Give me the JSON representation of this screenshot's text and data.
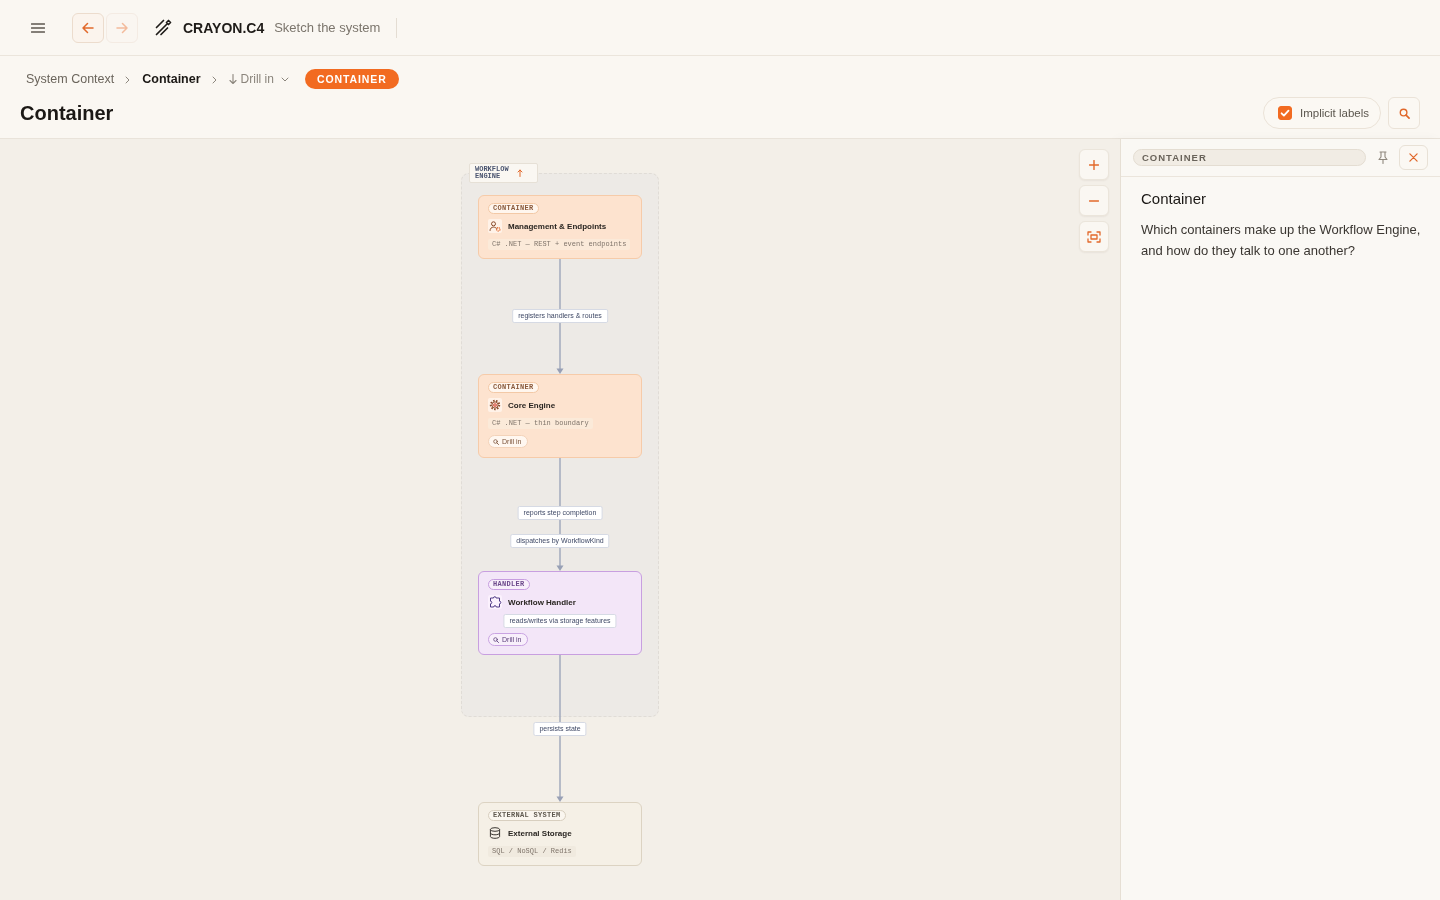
{
  "topbar": {
    "nav_buttons": [
      {
        "kind": "back",
        "disabled": false
      },
      {
        "kind": "forward",
        "disabled": true
      }
    ],
    "brand": "CRAYON.C4",
    "tagline": "Sketch the system"
  },
  "breadcrumbs": {
    "items": [
      {
        "label": "System Context",
        "selected": false
      },
      {
        "label": "Container",
        "selected": true
      }
    ],
    "drill_menu": {
      "label": "Drill in"
    },
    "level_badge": "CONTAINER"
  },
  "page_title": "Container",
  "toolbar": {
    "implicit_labels": {
      "label": "Implicit labels",
      "checked": true
    }
  },
  "diagram": {
    "boundary": {
      "label": "WORKFLOW ENGINE",
      "nodes": [
        {
          "kind": "container",
          "badge": "CONTAINER",
          "title": "Management & Endpoints",
          "tech": "C# .NET — REST + event endpoints"
        },
        {
          "kind": "container",
          "badge": "CONTAINER",
          "title": "Core Engine",
          "tech": "C# .NET — thin boundary",
          "drill_label": "Drill in"
        },
        {
          "kind": "handler",
          "badge": "HANDLER",
          "title": "Workflow Handler",
          "drill_label": "Drill in"
        }
      ]
    },
    "outside_nodes": [
      {
        "kind": "external",
        "badge": "EXTERNAL SYSTEM",
        "title": "External Storage",
        "tech": "SQL / NoSQL / Redis"
      }
    ],
    "edges": [
      {
        "label": "registers handlers & routes"
      },
      {
        "label": "reports step completion"
      },
      {
        "label": "dispatches by WorkflowKind"
      },
      {
        "label": "reads/writes via storage features"
      },
      {
        "label": "persists state"
      }
    ]
  },
  "panel": {
    "chip": "CONTAINER",
    "title": "Container",
    "description": "Which containers make up the Workflow Engine, and how do they talk to one another?"
  }
}
